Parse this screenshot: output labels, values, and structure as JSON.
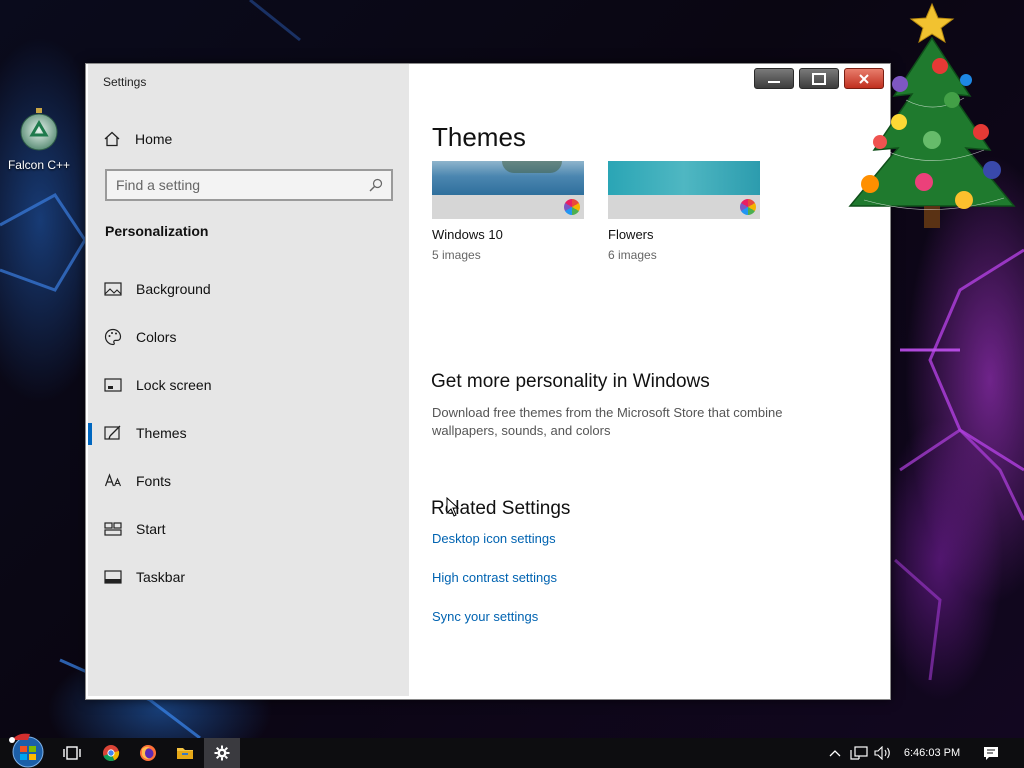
{
  "desktop": {
    "icons": [
      {
        "label": "Falcon C++",
        "icon": "recycle-bin-icon"
      }
    ]
  },
  "window": {
    "app_title": "Settings",
    "controls": {
      "minimize": "minimize-icon",
      "maximize": "maximize-icon",
      "close": "close-icon"
    }
  },
  "sidebar": {
    "home_label": "Home",
    "search": {
      "placeholder": "Find a setting",
      "value": ""
    },
    "section_label": "Personalization",
    "items": [
      {
        "label": "Background",
        "icon": "picture-icon",
        "active": false
      },
      {
        "label": "Colors",
        "icon": "palette-icon",
        "active": false
      },
      {
        "label": "Lock screen",
        "icon": "lock-screen-icon",
        "active": false
      },
      {
        "label": "Themes",
        "icon": "themes-icon",
        "active": true
      },
      {
        "label": "Fonts",
        "icon": "fonts-icon",
        "active": false
      },
      {
        "label": "Start",
        "icon": "start-icon",
        "active": false
      },
      {
        "label": "Taskbar",
        "icon": "taskbar-icon",
        "active": false
      }
    ]
  },
  "main": {
    "title": "Themes",
    "themes": [
      {
        "name": "Windows 10",
        "count": "5 images"
      },
      {
        "name": "Flowers",
        "count": "6 images"
      }
    ],
    "more": {
      "title": "Get more personality in Windows",
      "description": "Download free themes from the Microsoft Store that combine wallpapers, sounds, and colors"
    },
    "related": {
      "title": "Related Settings",
      "links": [
        "Desktop icon settings",
        "High contrast settings",
        "Sync your settings"
      ]
    }
  },
  "taskbar": {
    "apps": [
      "task-view-icon",
      "chrome-icon",
      "firefox-icon",
      "file-explorer-icon",
      "settings-gear-icon"
    ],
    "clock": "6:46:03 PM"
  },
  "colors": {
    "accent": "#0067c0",
    "link": "#0063b1",
    "sidebar_bg": "#e6e6e6"
  }
}
